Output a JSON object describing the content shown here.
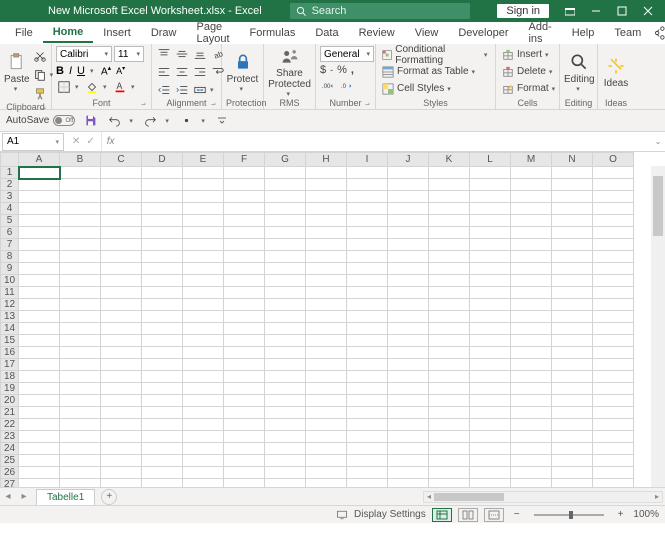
{
  "titlebar": {
    "title": "New Microsoft Excel Worksheet.xlsx  -  Excel",
    "search_placeholder": "Search",
    "signin": "Sign in"
  },
  "menu": {
    "tabs": [
      "File",
      "Home",
      "Insert",
      "Draw",
      "Page Layout",
      "Formulas",
      "Data",
      "Review",
      "View",
      "Developer",
      "Add-ins",
      "Help",
      "Team"
    ],
    "active": "Home"
  },
  "ribbon": {
    "clipboard": {
      "label": "Clipboard",
      "paste": "Paste"
    },
    "font": {
      "label": "Font",
      "name": "Calibri",
      "size": "11"
    },
    "alignment": {
      "label": "Alignment"
    },
    "protection": {
      "label": "Protection",
      "protect": "Protect"
    },
    "rms": {
      "label": "RMS",
      "share": "Share Protected"
    },
    "number": {
      "label": "Number",
      "format": "General",
      "currency": "$",
      "percent": "%",
      "comma": ","
    },
    "styles": {
      "label": "Styles",
      "cond": "Conditional Formatting",
      "table": "Format as Table",
      "cell": "Cell Styles"
    },
    "cells": {
      "label": "Cells",
      "insert": "Insert",
      "delete": "Delete",
      "format": "Format"
    },
    "editing": {
      "label": "Editing",
      "btn": "Editing"
    },
    "ideas": {
      "label": "Ideas",
      "btn": "Ideas"
    }
  },
  "qat": {
    "autosave": "AutoSave",
    "autosave_state": "Off"
  },
  "fbar": {
    "namebox": "A1",
    "fx": "fx"
  },
  "grid": {
    "cols": [
      "A",
      "B",
      "C",
      "D",
      "E",
      "F",
      "G",
      "H",
      "I",
      "J",
      "K",
      "L",
      "M",
      "N",
      "O"
    ],
    "rows": 27,
    "active_cell": "A1"
  },
  "sheetbar": {
    "tab": "Tabelle1"
  },
  "statusbar": {
    "display_settings": "Display Settings",
    "zoom": "100%"
  }
}
